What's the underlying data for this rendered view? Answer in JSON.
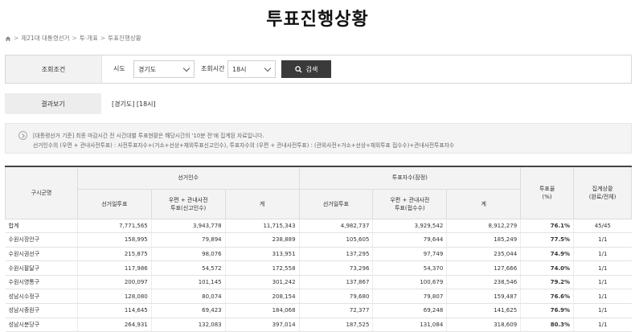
{
  "page": {
    "title": "투표진행상황"
  },
  "breadcrumb": [
    "제21대 대통령선거",
    "투·개표",
    "투표진행상황"
  ],
  "search": {
    "label": "조회조건",
    "sido_label": "시도",
    "sido_value": "경기도",
    "time_label": "조회시간",
    "time_value": "18시",
    "button_label": "검색"
  },
  "result": {
    "label": "결과보기",
    "value": "[경기도] [18시]"
  },
  "notice": {
    "line1": "[대통령선거 기준] 최종 마감시간 전 시간대별 투표현황은 해당시간의 '10분 전'에 집계된 자료입니다.",
    "line2": "선거인수의 (우편 + 관내사전투표) : 사전투표자수+(거소+선상+재외투표신고인수), 투표자수의 (우편 + 관내사전투표) : (관외사전+거소+선상+재외투표 접수수)+관내사전투표자수"
  },
  "table": {
    "headers": {
      "district": "구시군명",
      "electors": "선거인수",
      "voters": "투표자수(잠정)",
      "rate": "투표율\n(%)",
      "status": "집계상황\n(완료/전체)",
      "e_day": "선거일투표",
      "e_mail": "우편 + 관내사전\n투표(신고인수)",
      "e_total": "계",
      "v_day": "선거일투표",
      "v_mail": "우편 + 관내사전\n투표(접수수)",
      "v_total": "계"
    },
    "rows": [
      [
        "합계",
        "7,771,565",
        "3,943,778",
        "11,715,343",
        "4,982,737",
        "3,929,542",
        "8,912,279",
        "76.1%",
        "45/45"
      ],
      [
        "수원시장안구",
        "158,995",
        "79,894",
        "238,889",
        "105,605",
        "79,644",
        "185,249",
        "77.5%",
        "1/1"
      ],
      [
        "수원시권선구",
        "215,875",
        "98,076",
        "313,951",
        "137,295",
        "97,749",
        "235,044",
        "74.9%",
        "1/1"
      ],
      [
        "수원시팔달구",
        "117,986",
        "54,572",
        "172,558",
        "73,296",
        "54,370",
        "127,666",
        "74.0%",
        "1/1"
      ],
      [
        "수원시영통구",
        "200,097",
        "101,145",
        "301,242",
        "137,867",
        "100,679",
        "238,546",
        "79.2%",
        "1/1"
      ],
      [
        "성남시수정구",
        "128,080",
        "80,074",
        "208,154",
        "79,680",
        "79,807",
        "159,487",
        "76.6%",
        "1/1"
      ],
      [
        "성남시중원구",
        "114,645",
        "69,423",
        "184,068",
        "72,377",
        "69,248",
        "141,625",
        "76.9%",
        "1/1"
      ],
      [
        "성남시분당구",
        "264,931",
        "132,083",
        "397,014",
        "187,525",
        "131,084",
        "318,609",
        "80.3%",
        "1/1"
      ]
    ]
  }
}
